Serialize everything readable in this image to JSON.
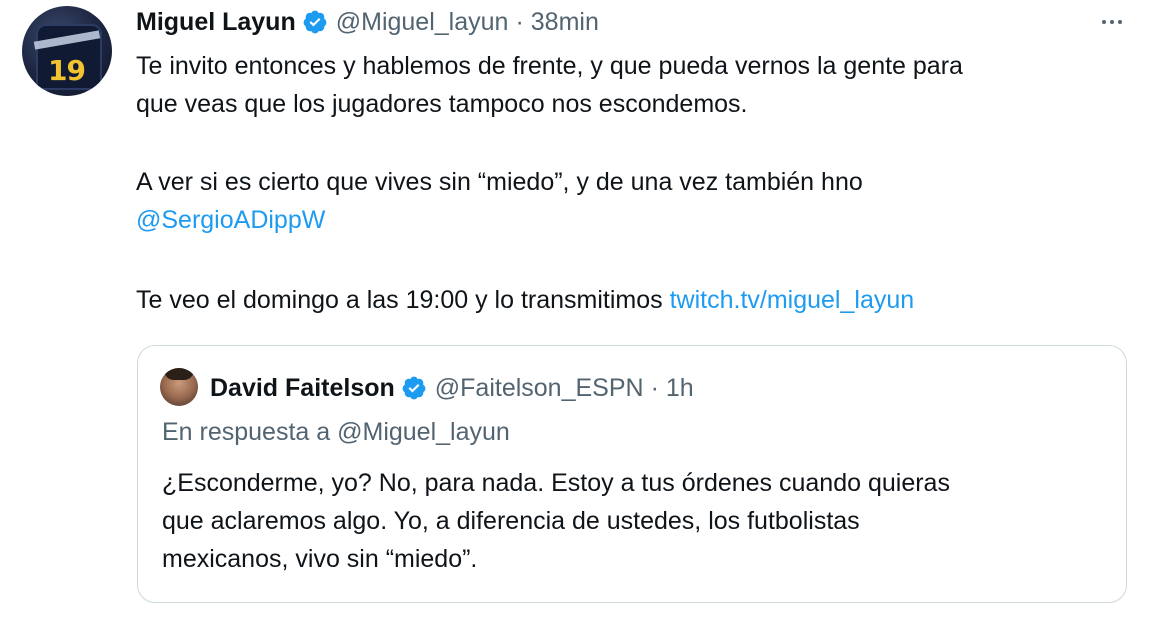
{
  "tweet": {
    "author_name": "Miguel Layun",
    "handle": "@Miguel_layun",
    "separator": "·",
    "time": "38min",
    "avatar_number": "19",
    "lines": {
      "p1_l1": "Te invito entonces y hablemos de frente, y que pueda vernos la gente para",
      "p1_l2": "que veas que los jugadores tampoco nos escondemos.",
      "p2_l1": "A ver si es cierto que vives sin “miedo”, y de una vez también hno",
      "p2_mention": "@SergioADippW",
      "p3_text": "Te veo el domingo a las 19:00 y lo transmitimos ",
      "p3_link": "twitch.tv/miguel_layun"
    }
  },
  "quoted_tweet": {
    "author_name": "David Faitelson",
    "handle": "@Faitelson_ESPN",
    "separator": "·",
    "time": "1h",
    "reply_to": "En respuesta a @Miguel_layun",
    "lines": {
      "l1": "¿Esconderme, yo? No, para nada. Estoy a tus órdenes cuando quieras",
      "l2": "que aclaremos algo. Yo, a diferencia de ustedes, los futbolistas",
      "l3": "mexicanos, vivo sin “miedo”."
    }
  },
  "icons": {
    "verified": "verified-badge-icon",
    "more": "more-options-icon"
  },
  "colors": {
    "text": "#0f1419",
    "secondary": "#536471",
    "link": "#1d9bf0",
    "verified": "#1d9bf0",
    "border": "#cfd9de"
  }
}
